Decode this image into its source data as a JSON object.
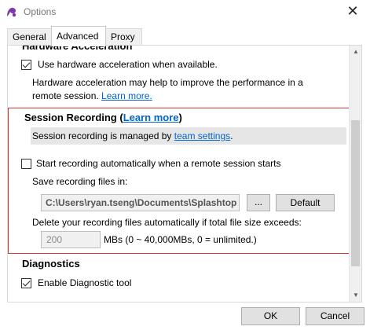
{
  "window": {
    "title": "Options",
    "close_glyph": "✕"
  },
  "tabs": [
    {
      "label": "General",
      "active": false
    },
    {
      "label": "Advanced",
      "active": true
    },
    {
      "label": "Proxy",
      "active": false
    }
  ],
  "hardware": {
    "section_title": "Hardware Acceleration",
    "checkbox_label": "Use hardware acceleration when available.",
    "checked": true,
    "description_line1": "Hardware acceleration may help to improve the performance in a",
    "description_line2": "remote session.",
    "learn_more": "Learn more."
  },
  "session_recording": {
    "title": "Session Recording",
    "title_open": "(",
    "learn_more": "Learn more",
    "title_close": ")",
    "managed_text": "Session recording is managed by",
    "managed_link": "team settings",
    "managed_suffix": ".",
    "auto_start_label": "Start recording automatically when a remote session starts",
    "auto_start_checked": false,
    "save_label": "Save recording files in:",
    "save_path": "C:\\Users\\ryan.tseng\\Documents\\Splashtop C",
    "browse_label": "...",
    "default_label": "Default",
    "delete_label": "Delete your recording files automatically if total file size exceeds:",
    "size_value": "200",
    "size_hint": "MBs (0 ~ 40,000MBs, 0 = unlimited.)"
  },
  "diagnostics": {
    "title": "Diagnostics",
    "checkbox_label": "Enable Diagnostic tool",
    "checked": true
  },
  "footer": {
    "ok_label": "OK",
    "cancel_label": "Cancel"
  },
  "colors": {
    "accent_link": "#0066cc",
    "highlight_border": "#d9342b"
  }
}
